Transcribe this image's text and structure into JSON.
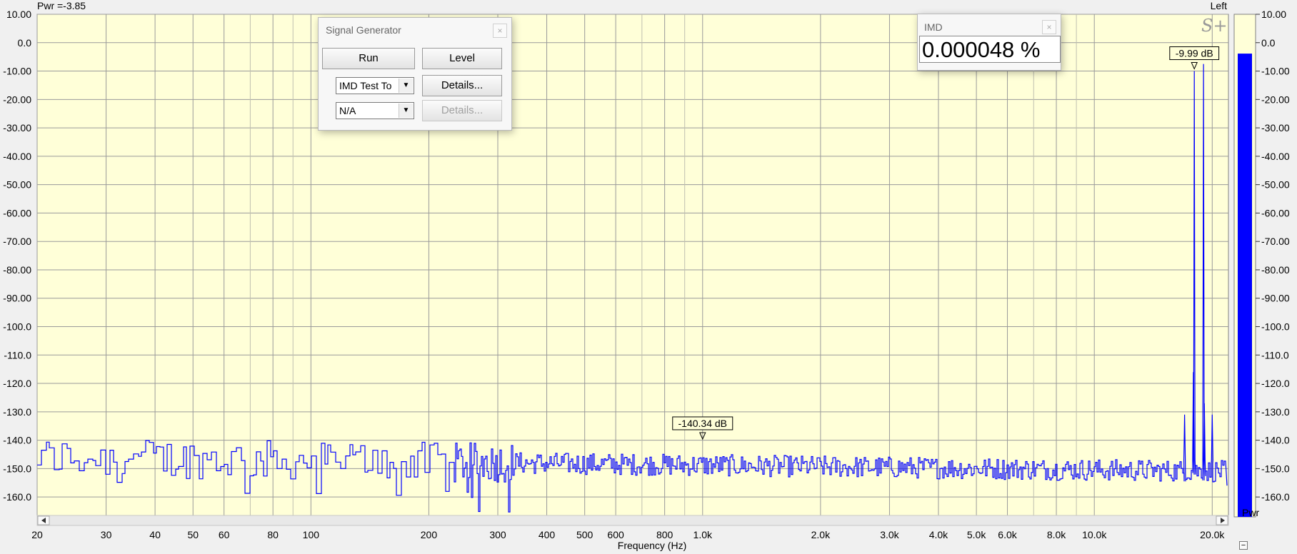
{
  "header": {
    "power_readout": "Pwr =-3.85",
    "channel": "Left"
  },
  "signal_generator": {
    "title": "Signal Generator",
    "close_glyph": "×",
    "run_label": "Run",
    "level_label": "Level",
    "waveform_select": "IMD Test To",
    "waveform_details": "Details...",
    "second_select": "N/A",
    "second_details": "Details..."
  },
  "imd_window": {
    "title": "IMD",
    "close_glyph": "×",
    "value": "0.000048 %"
  },
  "logo": "S+",
  "meter": {
    "label": "Pwr",
    "collapse_glyph": "−",
    "ticks": [
      "10.00",
      "0.0",
      "-10.00",
      "-20.00",
      "-30.00",
      "-40.00",
      "-50.00",
      "-60.00",
      "-70.00",
      "-80.00",
      "-90.00",
      "-100.0",
      "-110.0",
      "-120.0",
      "-130.0",
      "-140.0",
      "-150.0",
      "-160.0"
    ],
    "level_db": -3.85,
    "colors": {
      "background": "#ffffd8",
      "bar": "#0000ff"
    }
  },
  "chart_data": {
    "type": "line",
    "xlabel": "Frequency (Hz)",
    "ylabel": "",
    "xscale": "log",
    "xlim": [
      20,
      22000
    ],
    "ylim": [
      -167,
      10
    ],
    "y_ticks": [
      10,
      0,
      -10,
      -20,
      -30,
      -40,
      -50,
      -60,
      -70,
      -80,
      -90,
      -100,
      -110,
      -120,
      -130,
      -140,
      -150,
      -160
    ],
    "y_tick_labels": [
      "10.00",
      "0.0",
      "-10.00",
      "-20.00",
      "-30.00",
      "-40.00",
      "-50.00",
      "-60.00",
      "-70.00",
      "-80.00",
      "-90.00",
      "-100.0",
      "-110.0",
      "-120.0",
      "-130.0",
      "-140.0",
      "-150.0",
      "-160.0"
    ],
    "x_ticks": [
      20,
      30,
      40,
      50,
      60,
      80,
      100,
      200,
      300,
      400,
      500,
      600,
      800,
      1000,
      2000,
      3000,
      4000,
      5000,
      6000,
      8000,
      10000,
      20000
    ],
    "x_tick_labels": [
      "20",
      "30",
      "40",
      "50",
      "60",
      "80",
      "100",
      "200",
      "300",
      "400",
      "500",
      "600",
      "800",
      "1.0k",
      "2.0k",
      "3.0k",
      "4.0k",
      "5.0k",
      "6.0k",
      "8.0k",
      "10.0k",
      "20.0k"
    ],
    "minor_x_gridlines": [
      70,
      90,
      700,
      900,
      7000,
      9000
    ],
    "grid": true,
    "colors": {
      "plot_background": "#ffffd8",
      "grid": "#9a9a9a",
      "trace": "#0000ff"
    },
    "noise_floor": {
      "from_hz": 20,
      "to_hz": 22000,
      "level_db": -148,
      "spread_db": 14,
      "description_level_db_at_1k": -150
    },
    "series": [
      {
        "peaks": [
          {
            "x": 18000,
            "y": -9.99
          },
          {
            "x": 19000,
            "y": -7.5
          },
          {
            "x": 17000,
            "y": -131
          },
          {
            "x": 20000,
            "y": -131
          },
          {
            "x": 17900,
            "y": -116
          },
          {
            "x": 19100,
            "y": -127
          }
        ]
      }
    ],
    "annotations": [
      {
        "x": 18000,
        "y": -9.99,
        "text": "-9.99 dB"
      },
      {
        "x": 1000,
        "y": -140.34,
        "text": "-140.34 dB"
      }
    ]
  }
}
